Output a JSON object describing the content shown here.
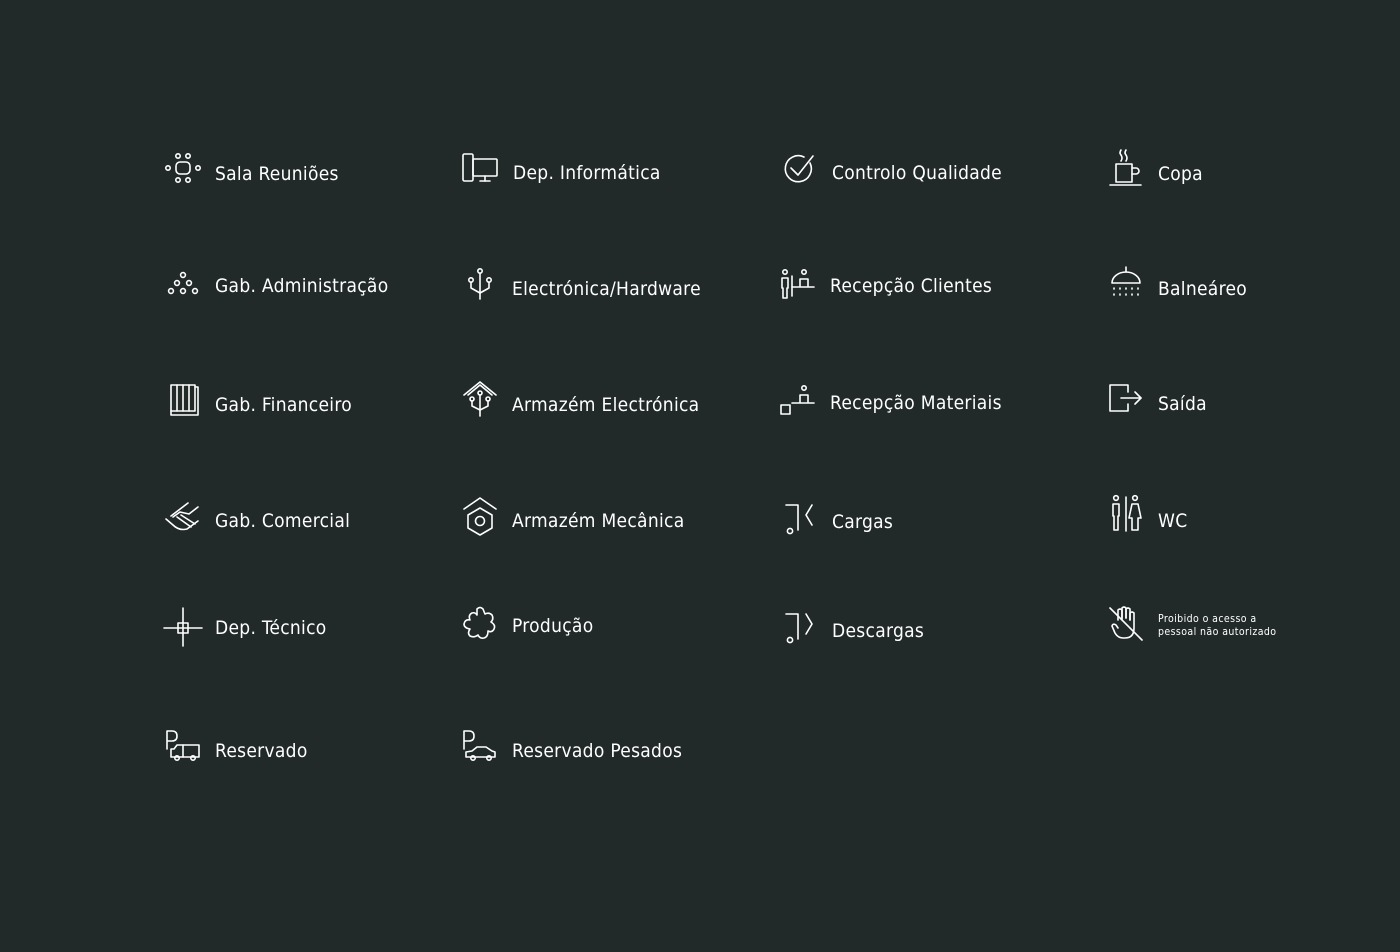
{
  "signs": {
    "sala_reunioes": {
      "label": "Sala Reuniões",
      "icon": "meeting-table-icon"
    },
    "dep_informatica": {
      "label": "Dep. Informática",
      "icon": "computer-icon"
    },
    "controlo_qualidade": {
      "label": "Controlo Qualidade",
      "icon": "check-circle-icon"
    },
    "copa": {
      "label": "Copa",
      "icon": "coffee-cup-icon"
    },
    "gab_administracao": {
      "label": "Gab. Administração",
      "icon": "people-pyramid-icon"
    },
    "electronica_hardware": {
      "label": "Electrónica/Hardware",
      "icon": "circuit-icon"
    },
    "recepcao_clientes": {
      "label": "Recepção Clientes",
      "icon": "reception-desk-icon"
    },
    "balneareo": {
      "label": "Balneáreo",
      "icon": "shower-icon"
    },
    "gab_financeiro": {
      "label": "Gab. Financeiro",
      "icon": "ledger-icon"
    },
    "armazem_electronica": {
      "label": "Armazém Electrónica",
      "icon": "warehouse-circuit-icon"
    },
    "recepcao_materiais": {
      "label": "Recepção Materiais",
      "icon": "materials-reception-icon"
    },
    "saida": {
      "label": "Saída",
      "icon": "exit-icon"
    },
    "gab_comercial": {
      "label": "Gab. Comercial",
      "icon": "handshake-icon"
    },
    "armazem_mecanica": {
      "label": "Armazém Mecânica",
      "icon": "warehouse-nut-icon"
    },
    "cargas": {
      "label": "Cargas",
      "icon": "loading-icon"
    },
    "wc": {
      "label": "WC",
      "icon": "restroom-icon"
    },
    "dep_tecnico": {
      "label": "Dep. Técnico",
      "icon": "crosshair-icon"
    },
    "producao": {
      "label": "Produção",
      "icon": "cog-icon"
    },
    "descargas": {
      "label": "Descargas",
      "icon": "unloading-icon"
    },
    "proibido": {
      "label": "Proibido o acesso a pessoal não autorizado",
      "icon": "no-entry-hand-icon"
    },
    "reservado": {
      "label": "Reservado",
      "icon": "parking-truck-icon"
    },
    "reservado_pesados": {
      "label": "Reservado Pesados",
      "icon": "parking-car-icon"
    }
  },
  "colors": {
    "background": "#212929",
    "foreground": "#ffffff"
  }
}
